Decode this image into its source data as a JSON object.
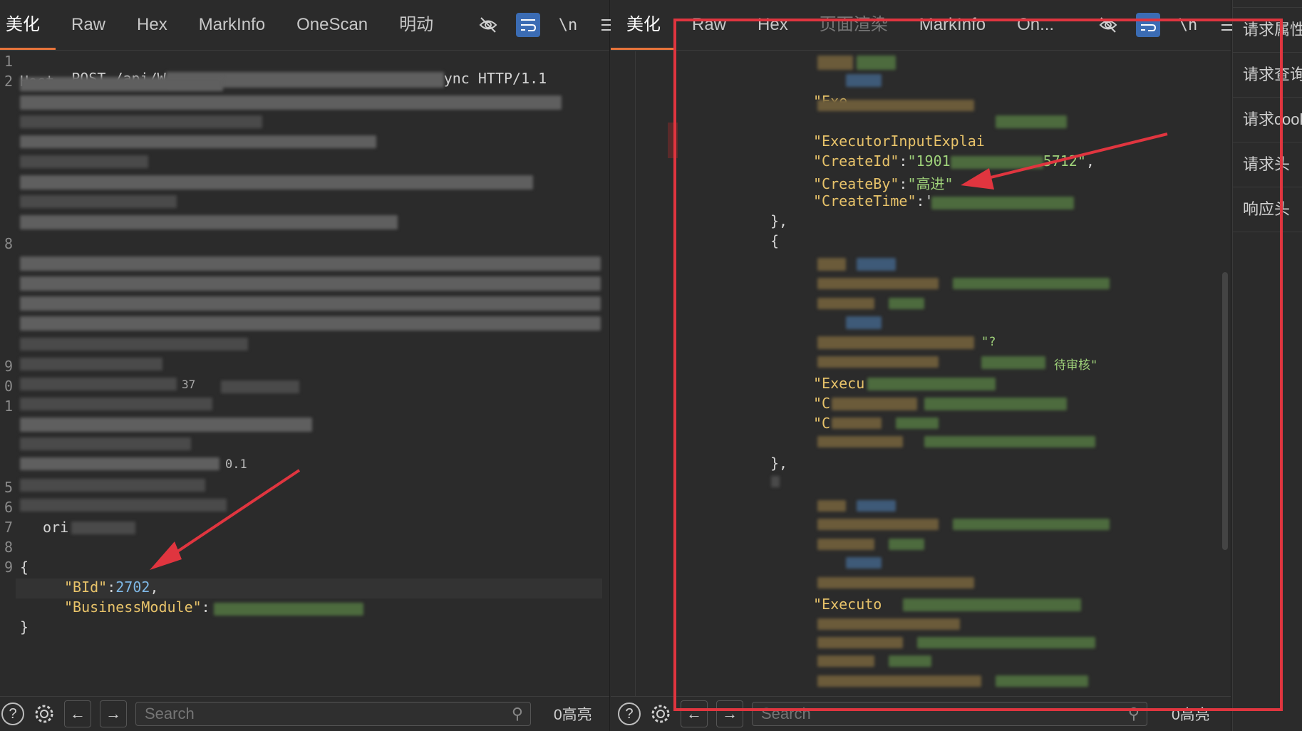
{
  "left": {
    "tabs": [
      {
        "label": "美化",
        "active": true
      },
      {
        "label": "Raw"
      },
      {
        "label": "Hex"
      },
      {
        "label": "MarkInfo"
      },
      {
        "label": "OneScan"
      },
      {
        "label": "明动"
      }
    ],
    "newline_toggle": "\\n",
    "request_line_start": "POST /api/W",
    "request_line_end": "ync HTTP/1.1",
    "host_fragment": "Host",
    "version_fragment": "0.1",
    "origin_fragment": "ori",
    "tick_fragment": "37",
    "line_numbers": [
      "1",
      "2",
      "8",
      "9",
      "0",
      "1",
      "5",
      "6",
      "7",
      "8",
      "9"
    ],
    "body": {
      "open_brace": "{",
      "bid_key": "\"BId\"",
      "bid_value": "2702",
      "module_key": "\"BusinessModule\"",
      "close_brace": "}"
    },
    "search_placeholder": "Search",
    "highlight_count": "0高亮"
  },
  "right": {
    "tabs": [
      {
        "label": "美化",
        "active": true
      },
      {
        "label": "Raw"
      },
      {
        "label": "Hex"
      },
      {
        "label": "页面渲染",
        "dim": true
      },
      {
        "label": "MarkInfo"
      },
      {
        "label": "On..."
      }
    ],
    "newline_toggle": "\\n",
    "json": {
      "exe_fragment": "\"Exe",
      "executor_input_key": "\"ExecutorInputExplai",
      "create_id_key": "\"CreateId\"",
      "create_id_start": "\"1901",
      "create_id_end": "5712\"",
      "create_by_key": "\"CreateBy\"",
      "create_by_value": "\"高进\"",
      "create_time_key": "\"CreateTime\"",
      "close_obj": "},",
      "open_obj": "{",
      "approve_fragment": "待审核\"",
      "quote_fragment": "\"?",
      "exec_fragment": "\"Execu",
      "c_fragment_1": "\"C",
      "c_fragment_2": "\"C",
      "executo_fragment": "\"Executo"
    },
    "search_placeholder": "Search",
    "highlight_count": "0高亮"
  },
  "side_panel": {
    "items": [
      "请求属性",
      "请求查询",
      "请求cookie",
      "请求头",
      "响应头"
    ]
  },
  "colors": {
    "background": "#2b2b2b",
    "active_tab_underline": "#e8743b",
    "annotation_red": "#e0353f",
    "json_key": "#e8c36a",
    "json_number": "#7fb8e6",
    "json_string": "#9fd27a"
  }
}
